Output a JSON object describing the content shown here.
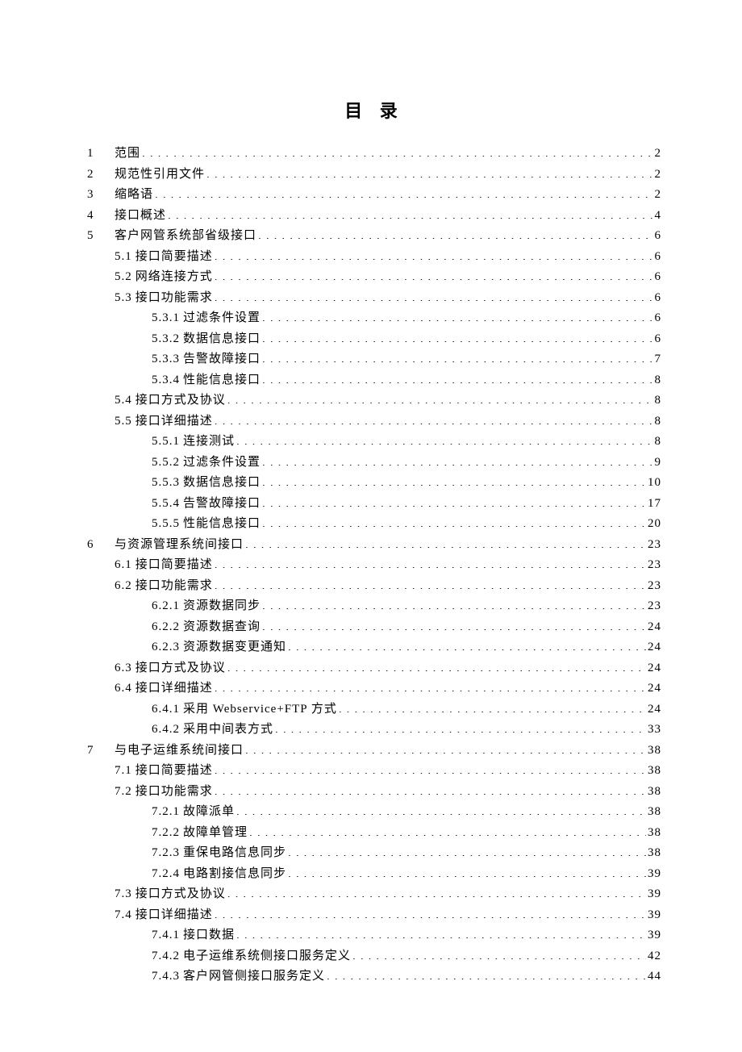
{
  "title": "目 录",
  "entries": [
    {
      "level": 0,
      "num": "1",
      "sub": "",
      "label": "范围",
      "page": "2"
    },
    {
      "level": 0,
      "num": "2",
      "sub": "",
      "label": "规范性引用文件",
      "page": "2"
    },
    {
      "level": 0,
      "num": "3",
      "sub": "",
      "label": "缩略语",
      "page": "2"
    },
    {
      "level": 0,
      "num": "4",
      "sub": "",
      "label": "接口概述",
      "page": "4"
    },
    {
      "level": 0,
      "num": "5",
      "sub": "",
      "label": "客户网管系统部省级接口",
      "page": "6"
    },
    {
      "level": 1,
      "num": "",
      "sub": "5.1",
      "label": "接口简要描述 ",
      "page": "6"
    },
    {
      "level": 1,
      "num": "",
      "sub": "5.2",
      "label": "网络连接方式 ",
      "page": "6"
    },
    {
      "level": 1,
      "num": "",
      "sub": "5.3",
      "label": "接口功能需求 ",
      "page": "6"
    },
    {
      "level": 2,
      "num": "",
      "sub": "5.3.1",
      "label": "过滤条件设置",
      "page": "6"
    },
    {
      "level": 2,
      "num": "",
      "sub": "5.3.2",
      "label": "数据信息接口",
      "page": "6"
    },
    {
      "level": 2,
      "num": "",
      "sub": "5.3.3",
      "label": "告警故障接口",
      "page": "7"
    },
    {
      "level": 2,
      "num": "",
      "sub": "5.3.4",
      "label": "性能信息接口",
      "page": "8"
    },
    {
      "level": 1,
      "num": "",
      "sub": "5.4",
      "label": "接口方式及协议 ",
      "page": "8"
    },
    {
      "level": 1,
      "num": "",
      "sub": "5.5",
      "label": "接口详细描述 ",
      "page": "8"
    },
    {
      "level": 2,
      "num": "",
      "sub": "5.5.1",
      "label": "连接测试",
      "page": "8"
    },
    {
      "level": 2,
      "num": "",
      "sub": "5.5.2",
      "label": "过滤条件设置",
      "page": "9"
    },
    {
      "level": 2,
      "num": "",
      "sub": "5.5.3",
      "label": "数据信息接口",
      "page": "10"
    },
    {
      "level": 2,
      "num": "",
      "sub": "5.5.4",
      "label": "告警故障接口",
      "page": "17"
    },
    {
      "level": 2,
      "num": "",
      "sub": "5.5.5",
      "label": "性能信息接口",
      "page": "20"
    },
    {
      "level": 0,
      "num": "6",
      "sub": "",
      "label": "与资源管理系统间接口",
      "page": "23"
    },
    {
      "level": 1,
      "num": "",
      "sub": "6.1",
      "label": "接口简要描述 ",
      "page": "23"
    },
    {
      "level": 1,
      "num": "",
      "sub": "6.2",
      "label": "接口功能需求 ",
      "page": "23"
    },
    {
      "level": 2,
      "num": "",
      "sub": "6.2.1",
      "label": "资源数据同步",
      "page": "23"
    },
    {
      "level": 2,
      "num": "",
      "sub": "6.2.2",
      "label": "资源数据查询",
      "page": "24"
    },
    {
      "level": 2,
      "num": "",
      "sub": "6.2.3",
      "label": "资源数据变更通知",
      "page": "24"
    },
    {
      "level": 1,
      "num": "",
      "sub": "6.3",
      "label": "接口方式及协议 ",
      "page": "24"
    },
    {
      "level": 1,
      "num": "",
      "sub": "6.4",
      "label": "接口详细描述 ",
      "page": "24"
    },
    {
      "level": 2,
      "num": "",
      "sub": "6.4.1",
      "label": "采用 Webservice+FTP 方式",
      "page": "24"
    },
    {
      "level": 2,
      "num": "",
      "sub": "6.4.2",
      "label": "采用中间表方式",
      "page": "33"
    },
    {
      "level": 0,
      "num": "7",
      "sub": "",
      "label": "与电子运维系统间接口",
      "page": "38"
    },
    {
      "level": 1,
      "num": "",
      "sub": "7.1",
      "label": "接口简要描述 ",
      "page": "38"
    },
    {
      "level": 1,
      "num": "",
      "sub": "7.2",
      "label": "接口功能需求 ",
      "page": "38"
    },
    {
      "level": 2,
      "num": "",
      "sub": "7.2.1",
      "label": "故障派单",
      "page": "38"
    },
    {
      "level": 2,
      "num": "",
      "sub": "7.2.2",
      "label": "故障单管理",
      "page": "38"
    },
    {
      "level": 2,
      "num": "",
      "sub": "7.2.3",
      "label": "重保电路信息同步",
      "page": "38"
    },
    {
      "level": 2,
      "num": "",
      "sub": "7.2.4",
      "label": "电路割接信息同步",
      "page": "39"
    },
    {
      "level": 1,
      "num": "",
      "sub": "7.3",
      "label": "接口方式及协议 ",
      "page": "39"
    },
    {
      "level": 1,
      "num": "",
      "sub": "7.4",
      "label": "接口详细描述 ",
      "page": "39"
    },
    {
      "level": 2,
      "num": "",
      "sub": "7.4.1",
      "label": "接口数据",
      "page": "39"
    },
    {
      "level": 2,
      "num": "",
      "sub": "7.4.2",
      "label": "电子运维系统侧接口服务定义",
      "page": "42"
    },
    {
      "level": 2,
      "num": "",
      "sub": "7.4.3",
      "label": "客户网管侧接口服务定义",
      "page": "44"
    }
  ]
}
